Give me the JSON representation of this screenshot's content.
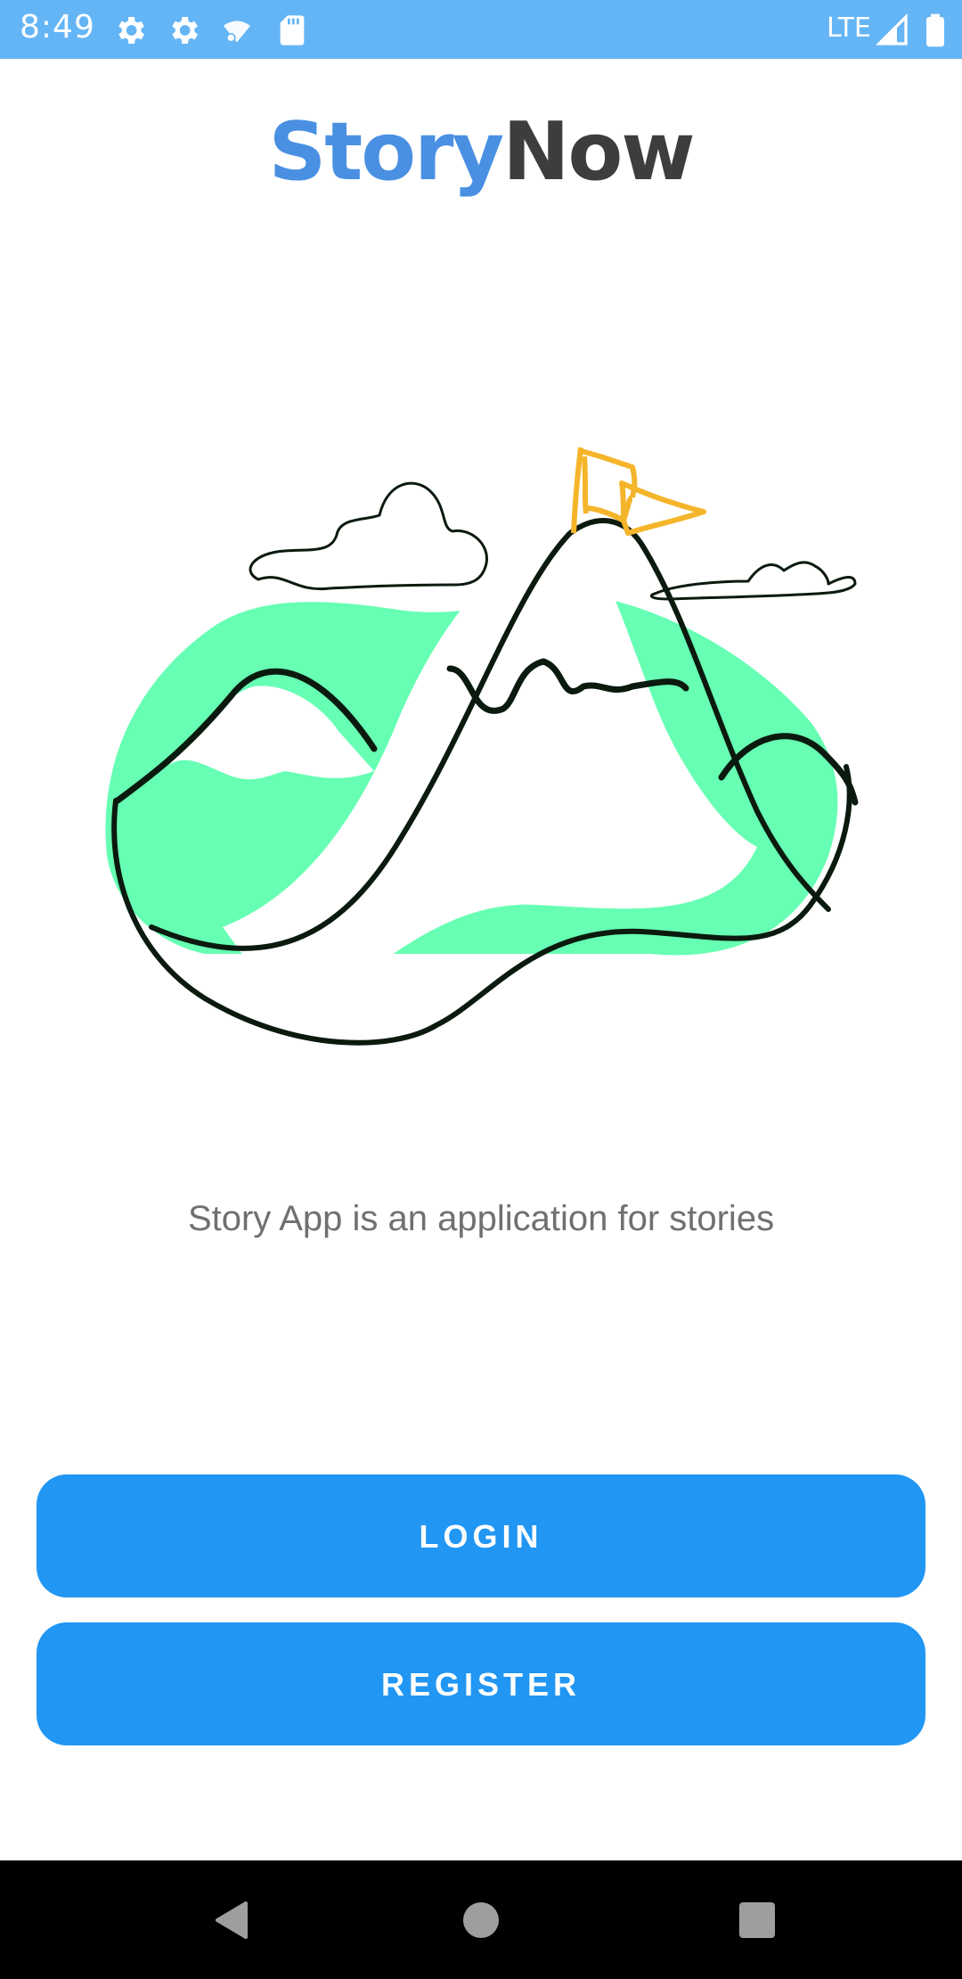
{
  "status_bar": {
    "time": "8:49",
    "network": "LTE",
    "icons": [
      "gear-icon",
      "gear-icon",
      "wifi-settings-icon",
      "sd-card-icon",
      "signal-icon",
      "battery-icon"
    ]
  },
  "app": {
    "title_part1": "Story",
    "title_part2": "Now"
  },
  "illustration": {
    "name": "mountain-flag-illustration",
    "colors": {
      "fill": "#66ffb3",
      "stroke": "#0b1a0e",
      "flag": "#f5b52a"
    }
  },
  "description": "Story App is an application for stories",
  "buttons": {
    "login": "LOGIN",
    "register": "REGISTER"
  },
  "nav_bar": {
    "icons": [
      "back-icon",
      "home-icon",
      "recents-icon"
    ]
  },
  "colors": {
    "status_bar": "#64b5f6",
    "primary_button": "#2196f3",
    "title_blue": "#4a90e2",
    "title_dark": "#3d3d3d"
  }
}
